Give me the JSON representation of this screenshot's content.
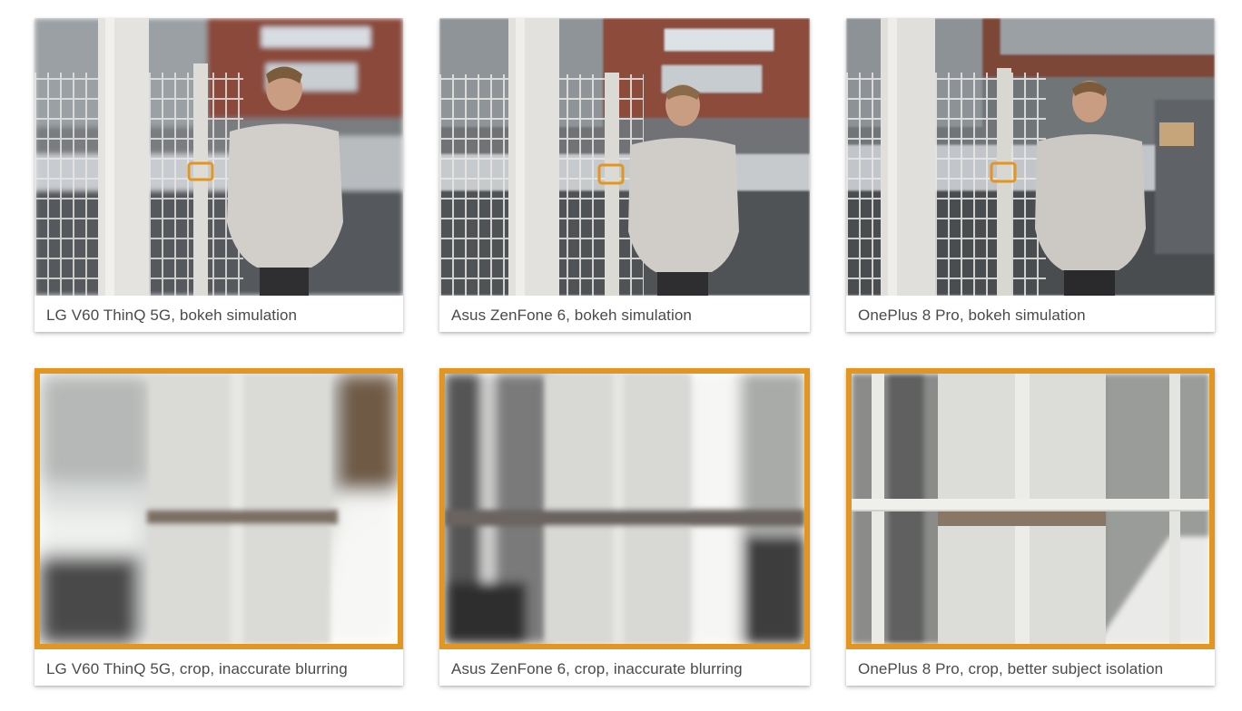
{
  "accent_color": "#e2961f",
  "row1": [
    {
      "caption": "LG V60 ThinQ 5G, bokeh simulation",
      "icon": "portrait-photo"
    },
    {
      "caption": "Asus ZenFone 6, bokeh simulation",
      "icon": "portrait-photo"
    },
    {
      "caption": "OnePlus 8 Pro, bokeh simulation",
      "icon": "portrait-photo"
    }
  ],
  "row2": [
    {
      "caption": "LG V60 ThinQ 5G, crop, inaccurate blurring",
      "icon": "crop-photo"
    },
    {
      "caption": "Asus ZenFone 6, crop, inaccurate blurring",
      "icon": "crop-photo"
    },
    {
      "caption": "OnePlus 8 Pro, crop, better subject isolation",
      "icon": "crop-photo"
    }
  ]
}
